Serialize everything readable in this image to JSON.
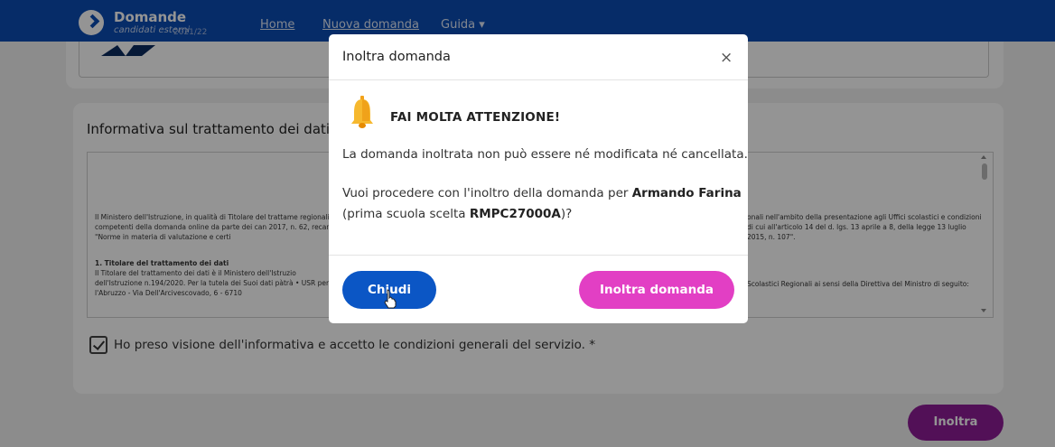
{
  "navbar": {
    "brand_title": "Domande",
    "brand_subtitle": "candidati esterni",
    "brand_year": "2021/22",
    "links": [
      "Home",
      "Nuova domanda",
      "Guida ▾"
    ]
  },
  "background": {
    "section_heading": "Informativa sul trattamento dei dati p",
    "para1": "Il Ministero dell'Istruzione, in qualità di Titolare del trattame regionali competenti della domanda online da parte dei can 2017, n. 62, recante \"Norme in materia di valutazione e certi",
    "section1_title": "1. Titolare del trattamento dei dati",
    "para2": "Il Titolare del trattamento dei dati è il Ministero dell'Istruzio dell'Istruzione n.194/2020. Per la tutela dei Suoi dati pàtrà • USR per l'Abruzzo - Via Dell'Arcivescovado, 6 - 6710",
    "para3": "onali nell'ambito della presentazione agli Uffici scolastici e condizioni di cui all'articolo 14 del d. lgs. 13 aprile a 8, della legge 13 luglio 2015, n. 107\".",
    "para4": "Scolastici Regionali ai sensi della Direttiva del Ministro di seguito:",
    "consent_text": "Ho preso visione dell'informativa e accetto le condizioni generali del servizio. *",
    "submit_label": "Inoltra"
  },
  "modal": {
    "title": "Inoltra domanda",
    "close_label": "×",
    "alert_title": "FAI MOLTA ATTENZIONE!",
    "line1": "La domanda inoltrata non può essere né modificata né cancellata.",
    "line2_prefix": "Vuoi procedere con l'inoltro della domanda per ",
    "candidate_name": "Armando Farina",
    "line3_prefix": "(prima scuola scelta ",
    "school_code": "RMPC27000A",
    "line3_suffix": ")?",
    "close_button": "Chiudi",
    "submit_button": "Inoltra domanda"
  },
  "colors": {
    "navbar": "#0c4db3",
    "primary_button": "#0b56c5",
    "accent_button": "#e23fc4",
    "page_submit": "#8e1d97"
  },
  "icons": [
    "bell-icon",
    "close-icon",
    "checkmark-icon",
    "cursor-icon"
  ]
}
